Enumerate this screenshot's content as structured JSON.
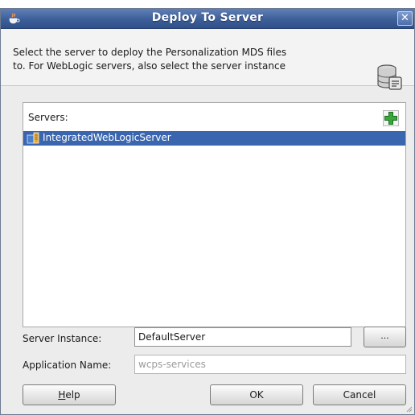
{
  "window": {
    "title": "Deploy To Server",
    "close_glyph": "✕"
  },
  "header": {
    "line1": "Select the server to deploy the Personalization MDS files",
    "line2": "to. For WebLogic servers, also select the server instance",
    "icon": "server-database-icon"
  },
  "servers": {
    "label": "Servers:",
    "add_icon": "add-green-plus-icon",
    "items": [
      {
        "label": "IntegratedWebLogicServer",
        "selected": true,
        "icon": "weblogic-server-icon"
      }
    ]
  },
  "form": {
    "server_instance_label": "Server Instance:",
    "server_instance_value": "DefaultServer",
    "browse_label": "...",
    "application_name_label": "Application Name:",
    "application_name_value": "wcps-services"
  },
  "buttons": {
    "help_mnemonic": "H",
    "help_rest": "elp",
    "ok": "OK",
    "cancel": "Cancel"
  },
  "colors": {
    "titlebar": "#3d5f99",
    "selection": "#3a66b0",
    "dialog_bg": "#ececec"
  }
}
